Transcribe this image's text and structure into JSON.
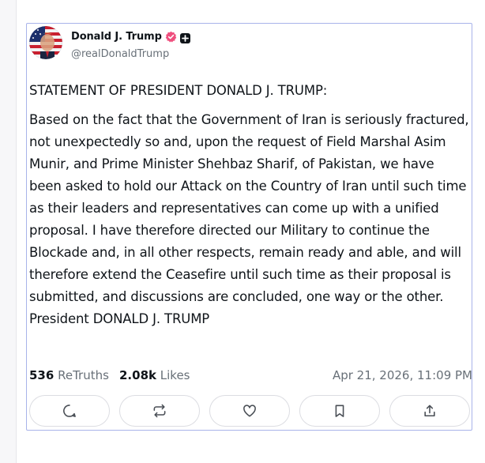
{
  "post": {
    "author": {
      "display_name": "Donald J. Trump",
      "handle": "@realDonaldTrump",
      "verified_color": "#ef4f7e"
    },
    "heading": "STATEMENT OF PRESIDENT DONALD J. TRUMP:",
    "body": "Based on the fact that the Government of Iran is seriously fractured, not unexpectedly so and, upon the request of Field Marshal Asim Munir, and Prime Minister Shehbaz Sharif, of Pakistan, we have been asked to hold our Attack on the Country of Iran until such time as their leaders and representatives can come up with a unified proposal. I have therefore directed our Military to continue the Blockade and, in all other respects, remain ready and able, and will therefore extend the Ceasefire until such time as their proposal is submitted, and discussions are concluded, one way or the other. President DONALD J. TRUMP",
    "stats": {
      "retruths_count": "536",
      "retruths_label": "ReTruths",
      "likes_count": "2.08k",
      "likes_label": "Likes"
    },
    "timestamp": "Apr 21, 2026, 11:09 PM",
    "actions": [
      {
        "icon": "reply-icon"
      },
      {
        "icon": "retruth-icon"
      },
      {
        "icon": "like-icon"
      },
      {
        "icon": "bookmark-icon"
      },
      {
        "icon": "share-icon"
      }
    ]
  },
  "colors": {
    "card_border": "#a8b3ea",
    "muted_text": "#687078",
    "icon_stroke": "#4a4f56"
  }
}
